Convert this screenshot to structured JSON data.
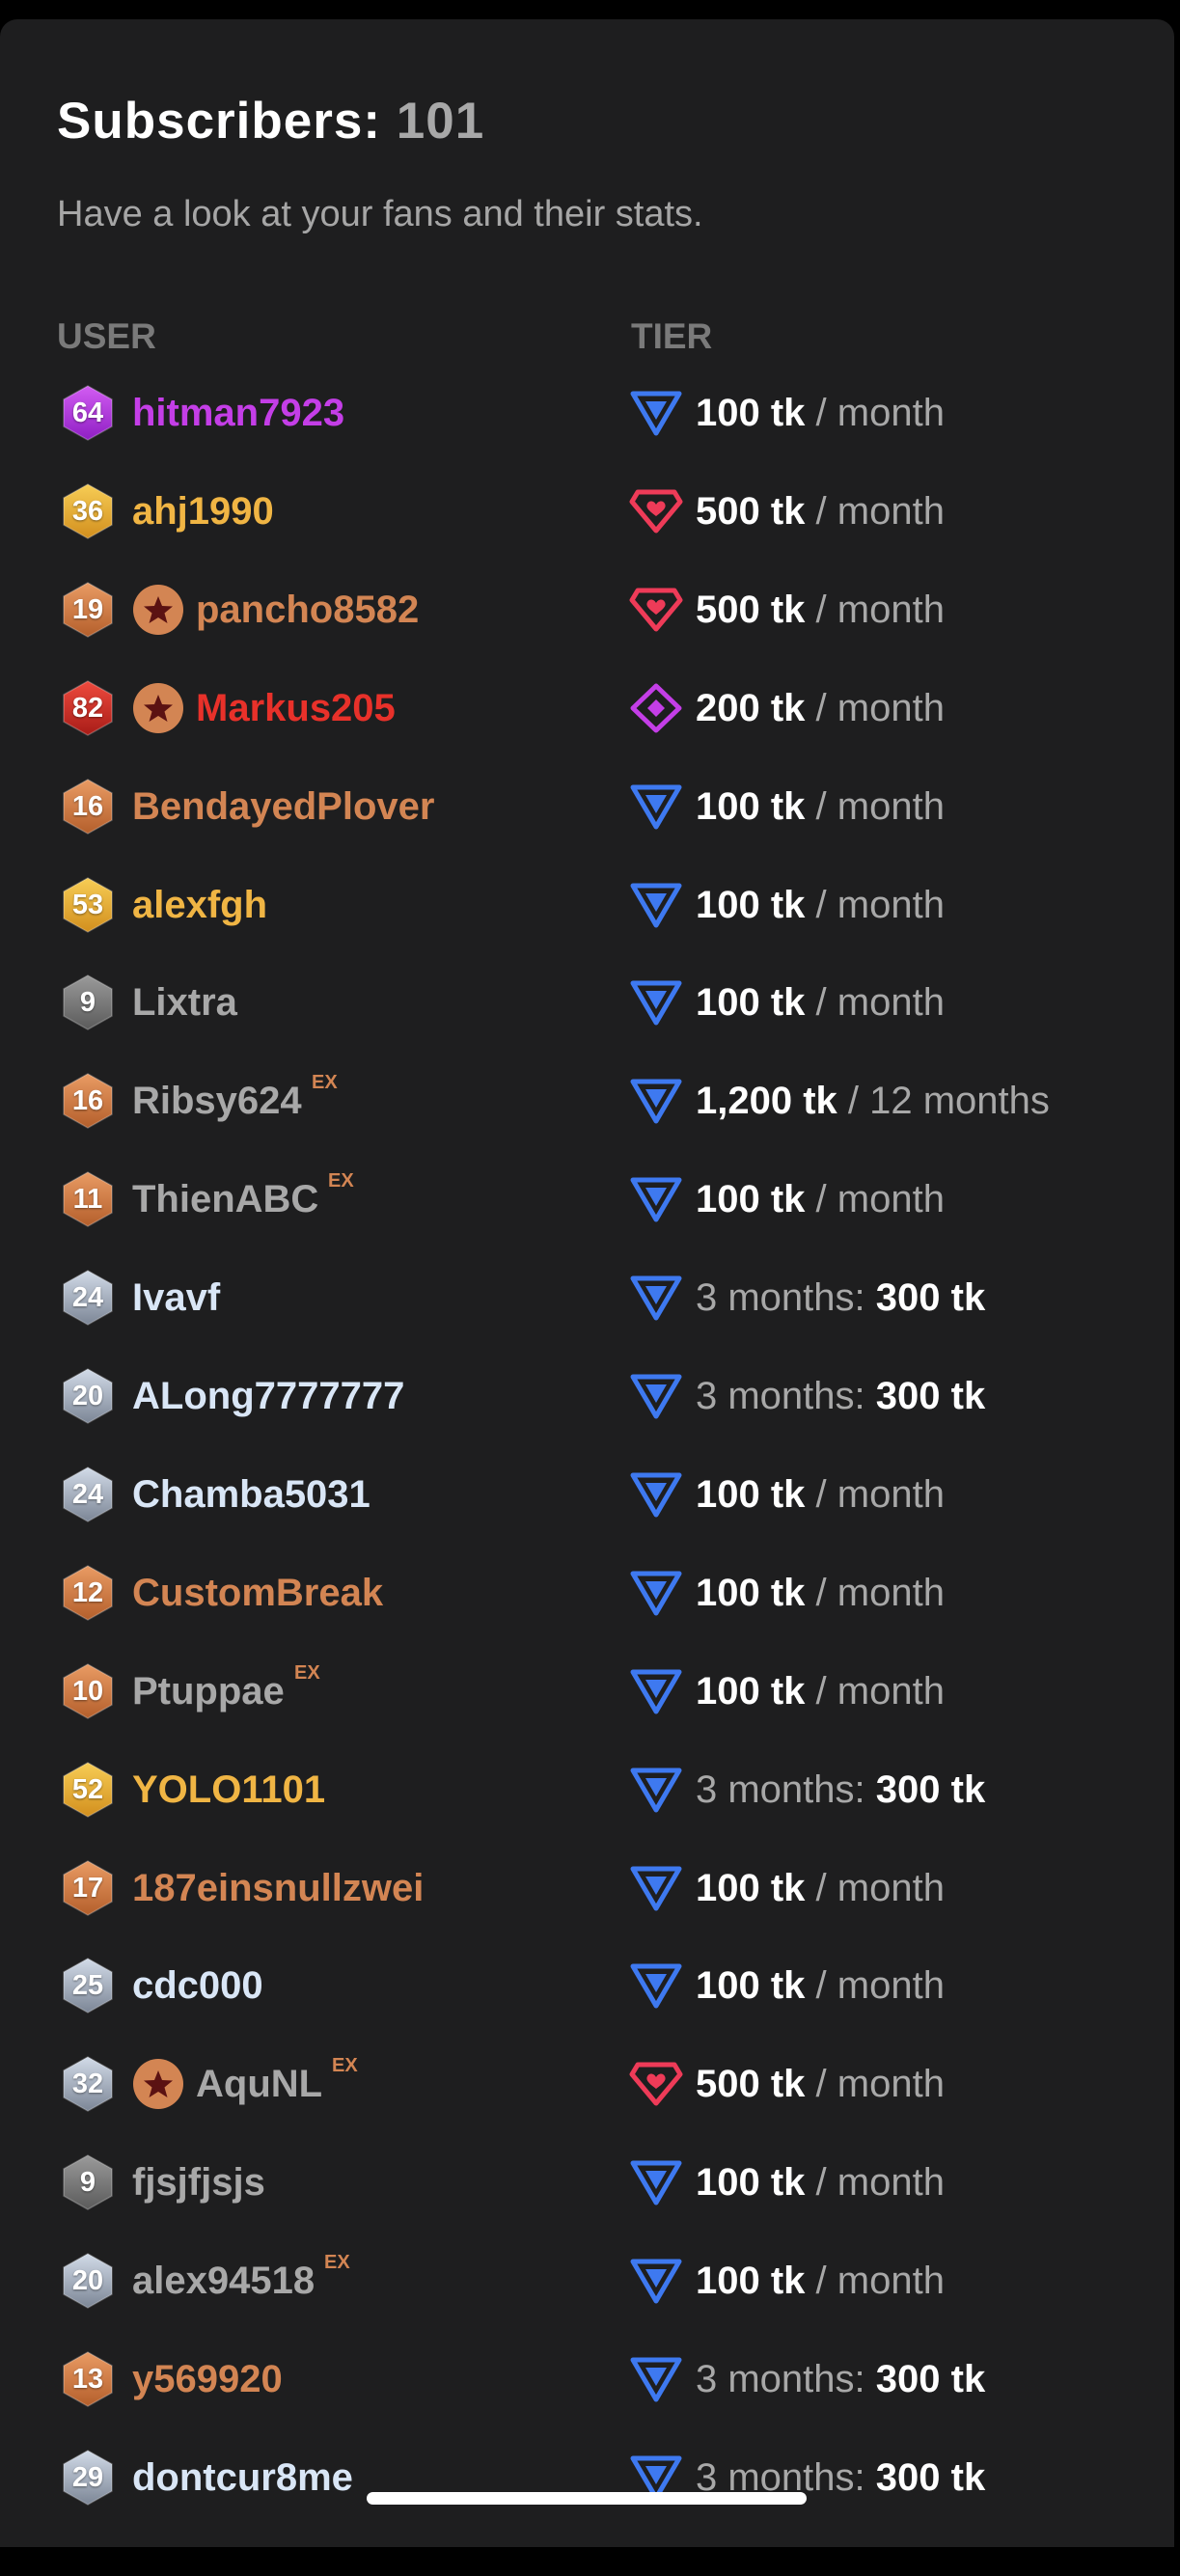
{
  "header": {
    "title_label": "Subscribers:",
    "title_count": "101",
    "subtitle": "Have a look at your fans and their stats.",
    "col_user": "USER",
    "col_tier": "TIER"
  },
  "colors": {
    "gold": "#f0b544",
    "bronze": "#d38553",
    "purple": "#c43ee7",
    "red": "#e8312a",
    "gray": "#a8a8a8",
    "silver": "#d9e6f6",
    "tier_basic": "#3e79f0",
    "tier_heart": "#ee3b58",
    "tier_diamond": "#c43ee7"
  },
  "rows": [
    {
      "level": "64",
      "badge": "purple",
      "name": "hitman7923",
      "name_color": "purple",
      "star": false,
      "ex": "",
      "tier_icon": "basic",
      "tier_style": "price",
      "price": "100 tk",
      "period": "/ month"
    },
    {
      "level": "36",
      "badge": "gold",
      "name": "ahj1990",
      "name_color": "gold",
      "star": false,
      "ex": "",
      "tier_icon": "heart",
      "tier_style": "price",
      "price": "500 tk",
      "period": "/ month"
    },
    {
      "level": "19",
      "badge": "bronze",
      "name": "pancho8582",
      "name_color": "bronze",
      "star": true,
      "ex": "",
      "tier_icon": "heart",
      "tier_style": "price",
      "price": "500 tk",
      "period": "/ month"
    },
    {
      "level": "82",
      "badge": "red",
      "name": "Markus205",
      "name_color": "red",
      "star": true,
      "ex": "",
      "tier_icon": "diamond",
      "tier_style": "price",
      "price": "200 tk",
      "period": "/ month"
    },
    {
      "level": "16",
      "badge": "bronze",
      "name": "BendayedPlover",
      "name_color": "bronze",
      "star": false,
      "ex": "",
      "tier_icon": "basic",
      "tier_style": "price",
      "price": "100 tk",
      "period": "/ month"
    },
    {
      "level": "53",
      "badge": "gold",
      "name": "alexfgh",
      "name_color": "gold",
      "star": false,
      "ex": "",
      "tier_icon": "basic",
      "tier_style": "price",
      "price": "100 tk",
      "period": "/ month"
    },
    {
      "level": "9",
      "badge": "gray",
      "name": "Lixtra",
      "name_color": "gray",
      "star": false,
      "ex": "",
      "tier_icon": "basic",
      "tier_style": "price",
      "price": "100 tk",
      "period": "/ month"
    },
    {
      "level": "16",
      "badge": "bronze",
      "name": "Ribsy624",
      "name_color": "gray",
      "star": false,
      "ex": "EX",
      "tier_icon": "basic",
      "tier_style": "price",
      "price": "1,200 tk",
      "period": "/ 12 months"
    },
    {
      "level": "11",
      "badge": "bronze",
      "name": "ThienABC",
      "name_color": "gray",
      "star": false,
      "ex": "EX",
      "tier_icon": "basic",
      "tier_style": "price",
      "price": "100 tk",
      "period": "/ month"
    },
    {
      "level": "24",
      "badge": "silver",
      "name": "Ivavf",
      "name_color": "silver",
      "star": false,
      "ex": "",
      "tier_icon": "basic",
      "tier_style": "duration",
      "duration": "3 months:",
      "price": "300 tk"
    },
    {
      "level": "20",
      "badge": "silver",
      "name": "ALong7777777",
      "name_color": "silver",
      "star": false,
      "ex": "",
      "tier_icon": "basic",
      "tier_style": "duration",
      "duration": "3 months:",
      "price": "300 tk"
    },
    {
      "level": "24",
      "badge": "silver",
      "name": "Chamba5031",
      "name_color": "silver",
      "star": false,
      "ex": "",
      "tier_icon": "basic",
      "tier_style": "price",
      "price": "100 tk",
      "period": "/ month"
    },
    {
      "level": "12",
      "badge": "bronze",
      "name": "CustomBreak",
      "name_color": "bronze",
      "star": false,
      "ex": "",
      "tier_icon": "basic",
      "tier_style": "price",
      "price": "100 tk",
      "period": "/ month"
    },
    {
      "level": "10",
      "badge": "bronze",
      "name": "Ptuppae",
      "name_color": "gray",
      "star": false,
      "ex": "EX",
      "tier_icon": "basic",
      "tier_style": "price",
      "price": "100 tk",
      "period": "/ month"
    },
    {
      "level": "52",
      "badge": "gold",
      "name": "YOLO1101",
      "name_color": "gold",
      "star": false,
      "ex": "",
      "tier_icon": "basic",
      "tier_style": "duration",
      "duration": "3 months:",
      "price": "300 tk"
    },
    {
      "level": "17",
      "badge": "bronze",
      "name": "187einsnullzwei",
      "name_color": "bronze",
      "star": false,
      "ex": "",
      "tier_icon": "basic",
      "tier_style": "price",
      "price": "100 tk",
      "period": "/ month"
    },
    {
      "level": "25",
      "badge": "silver",
      "name": "cdc000",
      "name_color": "silver",
      "star": false,
      "ex": "",
      "tier_icon": "basic",
      "tier_style": "price",
      "price": "100 tk",
      "period": "/ month"
    },
    {
      "level": "32",
      "badge": "silver",
      "name": "AquNL",
      "name_color": "gray",
      "star": true,
      "ex": "EX",
      "tier_icon": "heart",
      "tier_style": "price",
      "price": "500 tk",
      "period": "/ month"
    },
    {
      "level": "9",
      "badge": "gray",
      "name": "fjsjfjsjs",
      "name_color": "gray",
      "star": false,
      "ex": "",
      "tier_icon": "basic",
      "tier_style": "price",
      "price": "100 tk",
      "period": "/ month"
    },
    {
      "level": "20",
      "badge": "silver",
      "name": "alex94518",
      "name_color": "gray",
      "star": false,
      "ex": "EX",
      "tier_icon": "basic",
      "tier_style": "price",
      "price": "100 tk",
      "period": "/ month"
    },
    {
      "level": "13",
      "badge": "bronze",
      "name": "y569920",
      "name_color": "bronze",
      "star": false,
      "ex": "",
      "tier_icon": "basic",
      "tier_style": "duration",
      "duration": "3 months:",
      "price": "300 tk"
    },
    {
      "level": "29",
      "badge": "silver",
      "name": "dontcur8me",
      "name_color": "silver",
      "star": false,
      "ex": "",
      "tier_icon": "basic",
      "tier_style": "duration",
      "duration": "3 months:",
      "price": "300 tk"
    }
  ]
}
